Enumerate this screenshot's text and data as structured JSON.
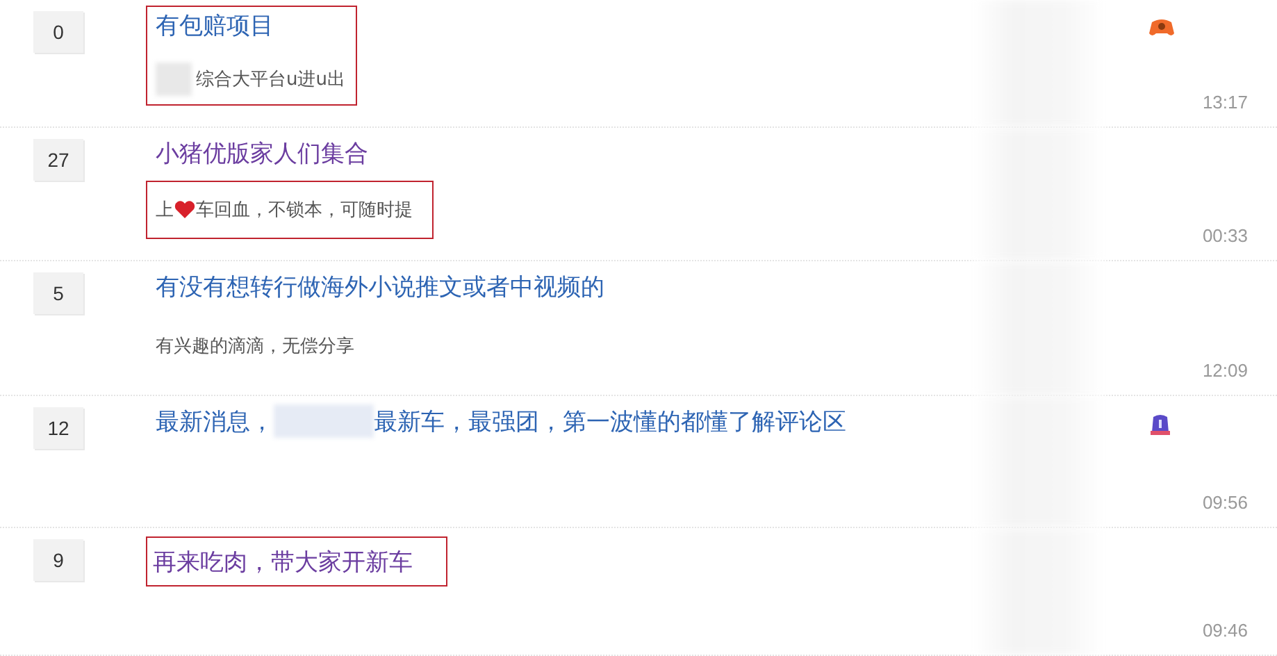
{
  "threads": [
    {
      "replies": "0",
      "visited": false,
      "title_boxed": true,
      "abstract_boxed": true,
      "title_parts": [
        {
          "kind": "text",
          "text": "有包赔项目"
        }
      ],
      "abstract_parts": [
        {
          "kind": "redacted"
        },
        {
          "kind": "text",
          "text": "综合大平台u进u出"
        }
      ],
      "badge": {
        "kind": "controller"
      },
      "time": "13:17"
    },
    {
      "replies": "27",
      "visited": true,
      "title_boxed": false,
      "abstract_boxed": true,
      "title_parts": [
        {
          "kind": "text",
          "text": "小猪优版家人们集合"
        }
      ],
      "abstract_parts": [
        {
          "kind": "text",
          "text": "上"
        },
        {
          "kind": "heart"
        },
        {
          "kind": "text",
          "text": "车回血，不锁本，可随时提"
        }
      ],
      "time": "00:33"
    },
    {
      "replies": "5",
      "visited": false,
      "title_boxed": false,
      "abstract_boxed": false,
      "title_parts": [
        {
          "kind": "text",
          "text": "有没有想转行做海外小说推文或者中视频的"
        }
      ],
      "abstract_parts": [
        {
          "kind": "text",
          "text": "有兴趣的滴滴，无偿分享"
        }
      ],
      "time": "12:09"
    },
    {
      "replies": "12",
      "visited": false,
      "title_boxed": false,
      "title_parts": [
        {
          "kind": "text",
          "text": "最新消息，"
        },
        {
          "kind": "redacted"
        },
        {
          "kind": "text",
          "text": "最新车，最强团，第一波懂的都懂了解评论区"
        }
      ],
      "badge": {
        "kind": "lantern"
      },
      "time": "09:56"
    },
    {
      "replies": "9",
      "visited": true,
      "title_boxed": true,
      "title_parts": [
        {
          "kind": "text",
          "text": "再来吃肉，带大家开新车"
        }
      ],
      "time": "09:46"
    }
  ]
}
